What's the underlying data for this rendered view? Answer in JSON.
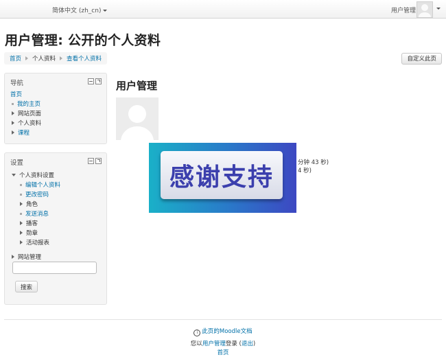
{
  "navbar": {
    "language": "简体中文 (zh_cn)",
    "user_name": "用户管理"
  },
  "header": {
    "title": "用户管理: 公开的个人资料",
    "breadcrumb": [
      "首页",
      "个人资料",
      "查看个人资料"
    ],
    "customize_button": "自定义此页"
  },
  "nav_block": {
    "title": "导航",
    "items": [
      "首页",
      "我的主页",
      "网站页面",
      "个人资料",
      "课程"
    ]
  },
  "settings_block": {
    "title": "设置",
    "group": "个人资料设置",
    "items": [
      "编辑个人资料",
      "更改密码",
      "角色",
      "发送消息",
      "播客",
      "勋章",
      "活动报表"
    ],
    "site_admin": "网站管理",
    "search_button": "搜索"
  },
  "main": {
    "heading": "用户管理",
    "detail_line_1": "分钟 43 秒)",
    "detail_line_2": "4 秒)"
  },
  "overlay": {
    "text": "感谢支持"
  },
  "footer": {
    "doc_link": "此页的Moodle文档",
    "login_prefix": "您以",
    "login_user": "用户管理",
    "login_mid": "登录 (",
    "logout": "退出",
    "login_suffix": ")",
    "home": "首页"
  },
  "colors": {
    "link": "#0070a8",
    "block_bg": "#f5f5f5",
    "banner_start": "#1ab0c8",
    "banner_end": "#3d48c2"
  }
}
